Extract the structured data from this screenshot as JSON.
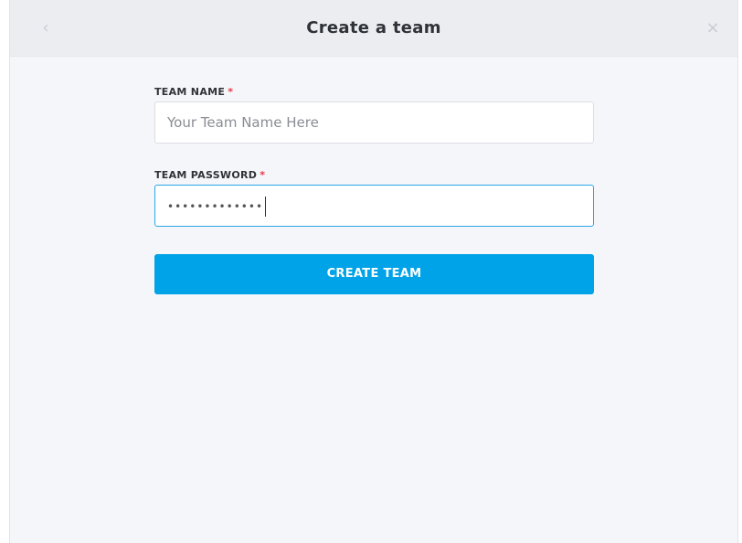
{
  "header": {
    "title": "Create a team",
    "back_icon": "‹",
    "close_icon": "×"
  },
  "form": {
    "team_name_label": "TEAM NAME",
    "team_name_placeholder": "Your Team Name Here",
    "team_password_label": "TEAM PASSWORD",
    "required_marker": "*",
    "team_password_masked": "•••••••••••••",
    "submit_label": "CREATE TEAM"
  },
  "colors": {
    "accent": "#00a3e8",
    "required": "#e8394b",
    "focus_border": "#2aa8e8"
  }
}
